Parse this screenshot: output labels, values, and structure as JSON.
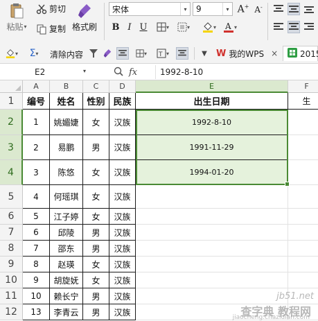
{
  "ribbon": {
    "paste_label": "粘贴",
    "cut_label": "剪切",
    "copy_label": "复制",
    "format_painter_label": "格式刷",
    "font_name": "宋体",
    "font_size": "9",
    "bold": "B",
    "italic": "I",
    "underline": "U",
    "clear_label": "清除内容"
  },
  "tabs": [
    {
      "label": "我的WPS",
      "close": "×"
    },
    {
      "label": "2015"
    }
  ],
  "formula_bar": {
    "name_box": "E2",
    "fx_label": "fx",
    "value": "1992-8-10"
  },
  "columns": [
    "A",
    "B",
    "C",
    "D",
    "E",
    "F"
  ],
  "rows": [
    {
      "num": "1",
      "cells": [
        "编号",
        "姓名",
        "性别",
        "民族",
        "出生日期",
        "生"
      ]
    },
    {
      "num": "2",
      "cells": [
        "1",
        "姚媚婕",
        "女",
        "汉族",
        "1992-8-10",
        ""
      ]
    },
    {
      "num": "3",
      "cells": [
        "2",
        "易鹏",
        "男",
        "汉族",
        "1991-11-29",
        ""
      ]
    },
    {
      "num": "4",
      "cells": [
        "3",
        "陈悠",
        "女",
        "汉族",
        "1994-01-20",
        ""
      ]
    },
    {
      "num": "5",
      "cells": [
        "4",
        "何瑶琪",
        "女",
        "汉族",
        "",
        ""
      ]
    },
    {
      "num": "6",
      "cells": [
        "5",
        "江子婷",
        "女",
        "汉族",
        "",
        ""
      ]
    },
    {
      "num": "7",
      "cells": [
        "6",
        "邱陵",
        "男",
        "汉族",
        "",
        ""
      ]
    },
    {
      "num": "8",
      "cells": [
        "7",
        "邵东",
        "男",
        "汉族",
        "",
        ""
      ]
    },
    {
      "num": "9",
      "cells": [
        "8",
        "赵瑛",
        "女",
        "汉族",
        "",
        ""
      ]
    },
    {
      "num": "10",
      "cells": [
        "9",
        "胡旋妩",
        "女",
        "汉族",
        "",
        ""
      ]
    },
    {
      "num": "11",
      "cells": [
        "10",
        "赖长宁",
        "男",
        "汉族",
        "",
        ""
      ]
    },
    {
      "num": "12",
      "cells": [
        "13",
        "李青云",
        "男",
        "汉族",
        "",
        ""
      ]
    }
  ],
  "watermark": {
    "site": "jb51.net",
    "cn": "查字典 教程网",
    "url": "jiaocheng.chazidian.com"
  },
  "colors": {
    "selection_green": "#4a8a34",
    "selection_fill": "#e5f2dc",
    "wps_red": "#d0312d"
  }
}
